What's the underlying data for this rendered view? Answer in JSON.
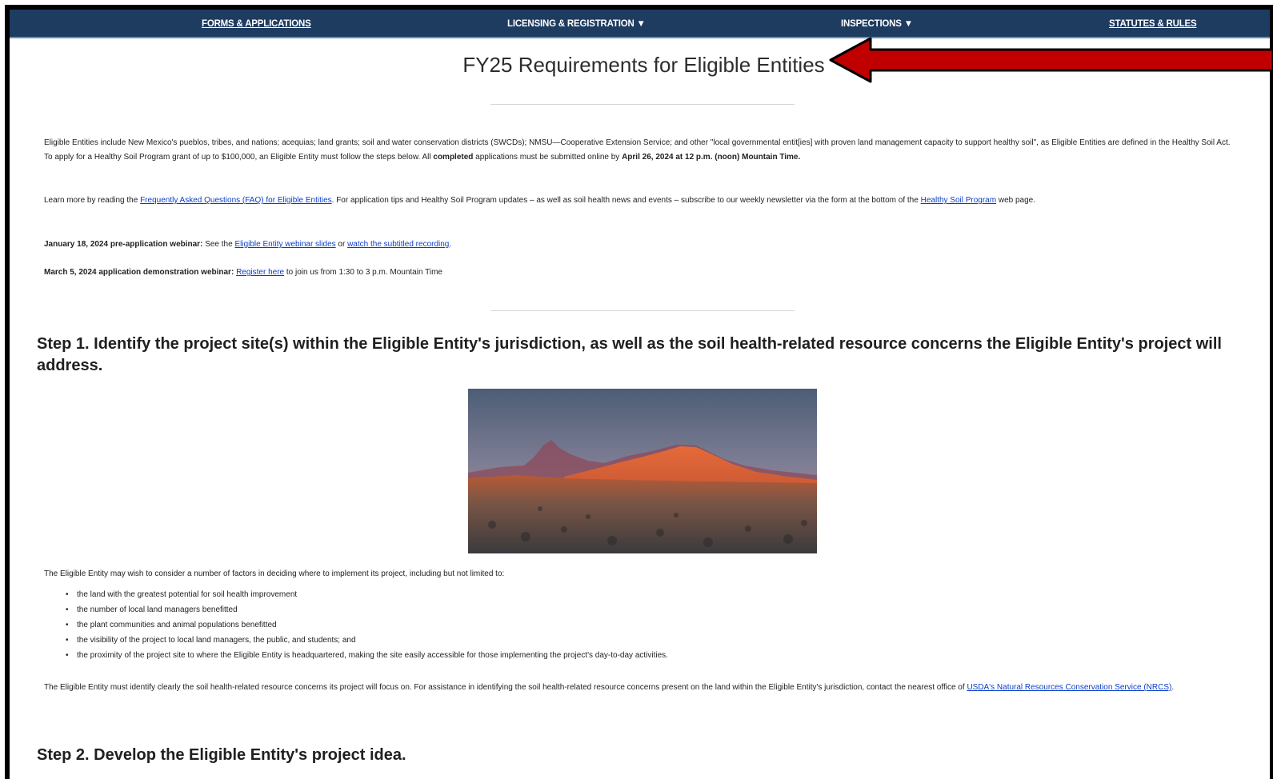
{
  "nav": {
    "forms": "FORMS & APPLICATIONS",
    "licensing": "LICENSING & REGISTRATION ▼",
    "inspections": "INSPECTIONS ▼",
    "statutes": "STATUTES & RULES"
  },
  "page": {
    "title": "FY25 Requirements for Eligible Entities"
  },
  "intro": {
    "p1_a": "Eligible Entities include New Mexico's pueblos, tribes, and nations; acequias; land grants; soil and water conservation districts (SWCDs); NMSU—Cooperative Extension Service; and other \"local governmental entit[ies] with proven land management capacity to support healthy soil\", as Eligible Entities are defined in the Healthy Soil Act. To apply for a Healthy Soil Program grant of up to $100,000, an Eligible Entity must follow the steps below. All ",
    "p1_b": "completed",
    "p1_c": " applications must be submitted online by ",
    "p1_d": "April 26, 2024 at 12 p.m. (noon) Mountain Time.",
    "p2_a": "Learn more by reading the ",
    "p2_link1": "Frequently Asked Questions (FAQ) for Eligible Entities",
    "p2_b": ". For application tips and Healthy Soil Program updates – as well as soil health news and events – subscribe to our weekly newsletter via the form at the bottom of the ",
    "p2_link2": "Healthy Soil Program",
    "p2_c": " web page.",
    "p3_bold": "January 18, 2024 pre-application webinar:",
    "p3_a": " See the ",
    "p3_link1": "Eligible Entity webinar slides",
    "p3_b": " or ",
    "p3_link2": "watch the subtitled recording",
    "p3_c": ".",
    "p4_bold": "March 5, 2024 application demonstration webinar:",
    "p4_a": " ",
    "p4_link": "Register here",
    "p4_b": " to join us from 1:30 to 3 p.m. Mountain Time"
  },
  "step1": {
    "heading": "Step 1. Identify the project site(s) within the Eligible Entity's jurisdiction, as well as the soil health-related resource concerns the Eligible Entity's project will address.",
    "lead": "The Eligible Entity may wish to consider a number of factors in deciding where to implement its project, including but not limited to:",
    "bullets": [
      "the land with the greatest potential for soil health improvement",
      "the number of local land managers benefitted",
      "the plant communities and animal populations benefitted",
      "the visibility of the project to local land managers, the public, and students; and",
      "the proximity of the project site to where the Eligible Entity is headquartered, making the site easily accessible for those implementing the project's day-to-day activities."
    ],
    "closing_a": "The Eligible Entity must identify clearly the soil health-related resource concerns its project will focus on. For assistance in identifying the soil health-related resource concerns present on the land within the Eligible Entity's jurisdiction, contact the nearest office of ",
    "closing_link": "USDA's Natural Resources Conservation Service (NRCS)",
    "closing_b": "."
  },
  "step2": {
    "heading": "Step 2. Develop the Eligible Entity's project idea."
  },
  "colors": {
    "nav_bg": "#1e3b60",
    "link": "#0b3ec9",
    "arrow": "#c00000"
  }
}
